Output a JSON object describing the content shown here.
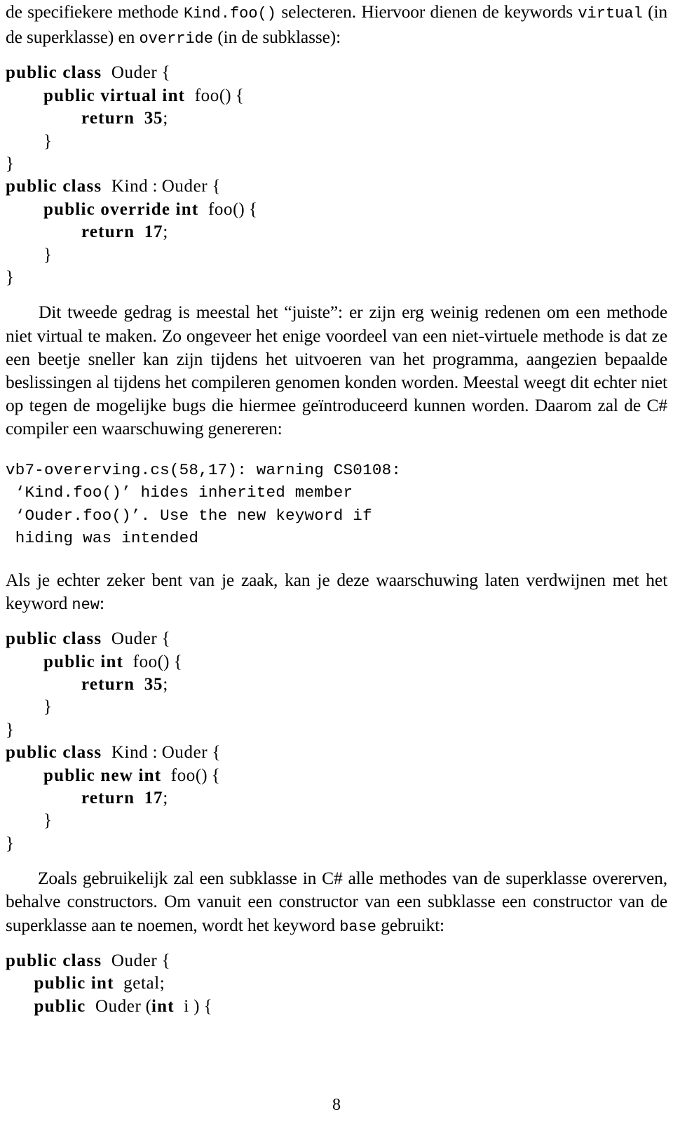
{
  "document": {
    "page_number": "8",
    "language": "nl"
  },
  "paragraphs": {
    "p1": {
      "segments": [
        {
          "text": "de specifiekere methode ",
          "style": "roman"
        },
        {
          "text": "Kind.foo()",
          "style": "tt"
        },
        {
          "text": " selecteren. Hiervoor dienen de keywords ",
          "style": "roman"
        },
        {
          "text": "virtual",
          "style": "tt"
        },
        {
          "text": " (in de superklasse) en ",
          "style": "roman"
        },
        {
          "text": "override",
          "style": "tt"
        },
        {
          "text": " (in de subklasse):",
          "style": "roman"
        }
      ]
    },
    "p2": {
      "segments": [
        {
          "text": "Dit tweede gedrag is meestal het “juiste”: er zijn erg weinig redenen om een methode niet virtual te maken. Zo ongeveer het enige voordeel van een niet-virtuele methode is dat ze een beetje sneller kan zijn tijdens het uitvoeren van het programma, aangezien bepaalde beslissingen al tijdens het compileren genomen konden worden. Meestal weegt dit echter niet op tegen de mogelijke bugs die hiermee geïntroduceerd kunnen worden. Daarom zal de C# compiler een waarschuwing genereren:",
          "style": "roman"
        }
      ]
    },
    "p3": {
      "segments": [
        {
          "text": "Als je echter zeker bent van je zaak, kan je deze waarschuwing laten verdwijnen met het keyword ",
          "style": "roman"
        },
        {
          "text": "new",
          "style": "tt"
        },
        {
          "text": ":",
          "style": "roman"
        }
      ]
    },
    "p4": {
      "segments": [
        {
          "text": "Zoals gebruikelijk zal een subklasse in C# alle methodes van de superklasse overerven, behalve constructors. Om vanuit een constructor van een subklasse een constructor van de superklasse aan te noemen, wordt het keyword ",
          "style": "roman"
        },
        {
          "text": "base",
          "style": "tt"
        },
        {
          "text": " gebruikt:",
          "style": "roman"
        }
      ]
    }
  },
  "code_blocks": {
    "block1": {
      "language": "csharp",
      "lines": [
        [
          {
            "t": "public class",
            "k": "kw"
          },
          {
            "t": " ",
            "k": "sp"
          },
          {
            "t": "Ouder",
            "k": "id"
          },
          {
            "t": " {",
            "k": "pun"
          }
        ],
        [
          {
            "t": "    ",
            "k": "sp"
          },
          {
            "t": "public virtual int",
            "k": "kw"
          },
          {
            "t": " ",
            "k": "sp"
          },
          {
            "t": "foo",
            "k": "id"
          },
          {
            "t": "() {",
            "k": "pun"
          }
        ],
        [
          {
            "t": "        ",
            "k": "sp"
          },
          {
            "t": "return",
            "k": "kw"
          },
          {
            "t": " ",
            "k": "sp"
          },
          {
            "t": "35",
            "k": "num"
          },
          {
            "t": ";",
            "k": "pun"
          }
        ],
        [
          {
            "t": "    ",
            "k": "sp"
          },
          {
            "t": "}",
            "k": "pun"
          }
        ],
        [
          {
            "t": "}",
            "k": "pun"
          }
        ],
        [
          {
            "t": "public class",
            "k": "kw"
          },
          {
            "t": " ",
            "k": "sp"
          },
          {
            "t": "Kind",
            "k": "id"
          },
          {
            "t": " : ",
            "k": "pun"
          },
          {
            "t": "Ouder",
            "k": "id"
          },
          {
            "t": " {",
            "k": "pun"
          }
        ],
        [
          {
            "t": "    ",
            "k": "sp"
          },
          {
            "t": "public override int",
            "k": "kw"
          },
          {
            "t": " ",
            "k": "sp"
          },
          {
            "t": "foo",
            "k": "id"
          },
          {
            "t": "() {",
            "k": "pun"
          }
        ],
        [
          {
            "t": "        ",
            "k": "sp"
          },
          {
            "t": "return",
            "k": "kw"
          },
          {
            "t": " ",
            "k": "sp"
          },
          {
            "t": "17",
            "k": "num"
          },
          {
            "t": ";",
            "k": "pun"
          }
        ],
        [
          {
            "t": "    ",
            "k": "sp"
          },
          {
            "t": "}",
            "k": "pun"
          }
        ],
        [
          {
            "t": "}",
            "k": "pun"
          }
        ]
      ]
    },
    "block2": {
      "language": "csharp",
      "lines": [
        [
          {
            "t": "public class",
            "k": "kw"
          },
          {
            "t": " ",
            "k": "sp"
          },
          {
            "t": "Ouder",
            "k": "id"
          },
          {
            "t": " {",
            "k": "pun"
          }
        ],
        [
          {
            "t": "    ",
            "k": "sp"
          },
          {
            "t": "public int",
            "k": "kw"
          },
          {
            "t": " ",
            "k": "sp"
          },
          {
            "t": "foo",
            "k": "id"
          },
          {
            "t": "() {",
            "k": "pun"
          }
        ],
        [
          {
            "t": "        ",
            "k": "sp"
          },
          {
            "t": "return",
            "k": "kw"
          },
          {
            "t": " ",
            "k": "sp"
          },
          {
            "t": "35",
            "k": "num"
          },
          {
            "t": ";",
            "k": "pun"
          }
        ],
        [
          {
            "t": "    ",
            "k": "sp"
          },
          {
            "t": "}",
            "k": "pun"
          }
        ],
        [
          {
            "t": "}",
            "k": "pun"
          }
        ],
        [
          {
            "t": "public class",
            "k": "kw"
          },
          {
            "t": " ",
            "k": "sp"
          },
          {
            "t": "Kind",
            "k": "id"
          },
          {
            "t": " : ",
            "k": "pun"
          },
          {
            "t": "Ouder",
            "k": "id"
          },
          {
            "t": " {",
            "k": "pun"
          }
        ],
        [
          {
            "t": "    ",
            "k": "sp"
          },
          {
            "t": "public new int",
            "k": "kw"
          },
          {
            "t": " ",
            "k": "sp"
          },
          {
            "t": "foo",
            "k": "id"
          },
          {
            "t": "() {",
            "k": "pun"
          }
        ],
        [
          {
            "t": "        ",
            "k": "sp"
          },
          {
            "t": "return",
            "k": "kw"
          },
          {
            "t": " ",
            "k": "sp"
          },
          {
            "t": "17",
            "k": "num"
          },
          {
            "t": ";",
            "k": "pun"
          }
        ],
        [
          {
            "t": "    ",
            "k": "sp"
          },
          {
            "t": "}",
            "k": "pun"
          }
        ],
        [
          {
            "t": "}",
            "k": "pun"
          }
        ]
      ]
    },
    "block3": {
      "language": "csharp",
      "lines": [
        [
          {
            "t": "public class",
            "k": "kw"
          },
          {
            "t": " ",
            "k": "sp"
          },
          {
            "t": "Ouder",
            "k": "id"
          },
          {
            "t": " {",
            "k": "pun"
          }
        ],
        [
          {
            "t": "   ",
            "k": "sp"
          },
          {
            "t": "public int",
            "k": "kw"
          },
          {
            "t": " ",
            "k": "sp"
          },
          {
            "t": "getal",
            "k": "id"
          },
          {
            "t": ";",
            "k": "pun"
          }
        ],
        [
          {
            "t": "   ",
            "k": "sp"
          },
          {
            "t": "public",
            "k": "kw"
          },
          {
            "t": " ",
            "k": "sp"
          },
          {
            "t": "Ouder",
            "k": "id"
          },
          {
            "t": " (",
            "k": "pun"
          },
          {
            "t": "int",
            "k": "kw"
          },
          {
            "t": " ",
            "k": "sp"
          },
          {
            "t": "i",
            "k": "id"
          },
          {
            "t": " ) {",
            "k": "pun"
          }
        ]
      ]
    }
  },
  "compiler_output": {
    "lines": [
      "vb7-overerving.cs(58,17): warning CS0108:",
      " ‘Kind.foo()’ hides inherited member",
      " ‘Ouder.foo()’. Use the new keyword if",
      " hiding was intended"
    ]
  }
}
